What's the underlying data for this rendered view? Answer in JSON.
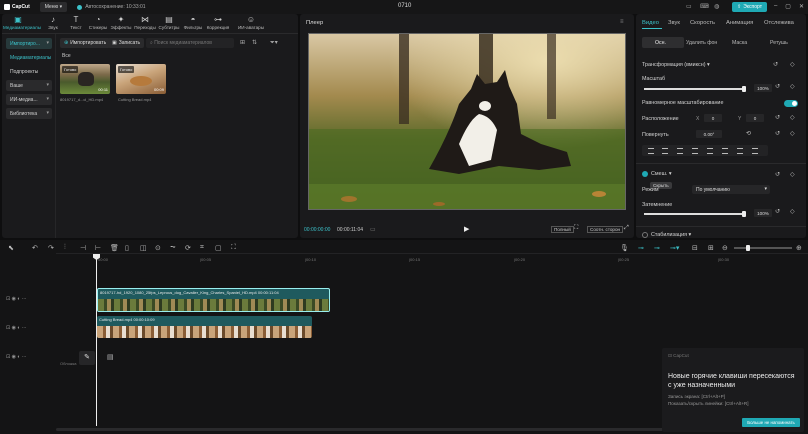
{
  "titlebar": {
    "logo": "CapCut",
    "menu": "Меню",
    "autosave": "Автосохранение: 10:33:01",
    "project": "0710",
    "export": "Экспорт"
  },
  "toolbar": [
    {
      "label": "Медиаматериалы",
      "icon": "media-icon"
    },
    {
      "label": "Звук",
      "icon": "music-icon"
    },
    {
      "label": "Текст",
      "icon": "text-icon"
    },
    {
      "label": "Стикеры",
      "icon": "sticker-icon"
    },
    {
      "label": "Эффекты",
      "icon": "effects-icon"
    },
    {
      "label": "Переходы",
      "icon": "transition-icon"
    },
    {
      "label": "Субтитры",
      "icon": "subtitles-icon"
    },
    {
      "label": "Фильтры",
      "icon": "filter-icon"
    },
    {
      "label": "Коррекция",
      "icon": "adjust-icon"
    },
    {
      "label": "ИИ-аватары",
      "icon": "avatar-icon"
    }
  ],
  "sidebar": {
    "items": [
      {
        "label": "Импортиро...",
        "dropdown": true
      },
      {
        "label": "Медиаматериалы",
        "dropdown": false
      },
      {
        "label": "Подпроекты",
        "dropdown": false
      },
      {
        "label": "Ваше",
        "dropdown": true
      },
      {
        "label": "ИИ-медиа...",
        "dropdown": true
      },
      {
        "label": "Библиотека",
        "dropdown": true
      }
    ]
  },
  "media": {
    "import": "Импортировать",
    "record": "Записать",
    "search_placeholder": "Поиск медиаматериалов",
    "all": "Все",
    "items": [
      {
        "tag": "Готово",
        "name": "8019717_d...cl_HD.mp4",
        "time": "00:11"
      },
      {
        "tag": "Готово",
        "name": "Cutting Bread.mp4",
        "time": "00:09"
      }
    ]
  },
  "player": {
    "title": "Плеер",
    "time_current": "00:00:00:00",
    "time_total": "00:00:11:04",
    "full": "Полный",
    "ratio": "Соотн. сторон"
  },
  "right": {
    "tabs": [
      "Видео",
      "Звук",
      "Скорость",
      "Анимация",
      "Отслежива"
    ],
    "subtabs": [
      "Осн.",
      "Удалить фон",
      "Маска",
      "Ретушь"
    ],
    "transform": "Трансформация (вмиксн)",
    "scale": {
      "label": "Масштаб",
      "value": "100%",
      "fraction": 1.0
    },
    "uniform": "Равномерное масштабирование",
    "position": {
      "label": "Расположение",
      "x_label": "X",
      "x": "0",
      "y_label": "Y",
      "y": "0"
    },
    "rotate": {
      "label": "Повернуть",
      "value": "0.00°"
    },
    "blend": {
      "label": "Смеш.",
      "tooltip": "Скрыть"
    },
    "mode": {
      "label": "Режим",
      "value": "По умолчанию"
    },
    "opacity": {
      "label": "Затемнение",
      "value": "100%",
      "fraction": 1.0
    },
    "stabilize": "Стабилизация"
  },
  "timeline": {
    "ticks": [
      "00:00",
      "|00:05",
      "|00:10",
      "|00:15",
      "|00:20",
      "|00:25",
      "|00:30"
    ],
    "clips": [
      {
        "title": "8019717-hd_1920_1080_25fps_Leprous_dog_Cavalier_King_Charles_Spaniel_HD.mp4   00:00:11:04"
      },
      {
        "title": "Cutting Bread.mp4   00:00:10:09"
      }
    ],
    "cover": "Обложка"
  },
  "notification": {
    "app": "CapCut",
    "title": "Новые горячие клавиши пересекаются с уже назначенными",
    "line1": "Запись экрана: [Ctrl+Alt+P]",
    "line2": "Показать/скрыть линейки: [Ctrl+Alt+R]",
    "button": "Больше не напоминать"
  },
  "colors": {
    "accent": "#1fa9b4",
    "bg": "#0e0e0f",
    "panel": "#1a1a1c"
  }
}
